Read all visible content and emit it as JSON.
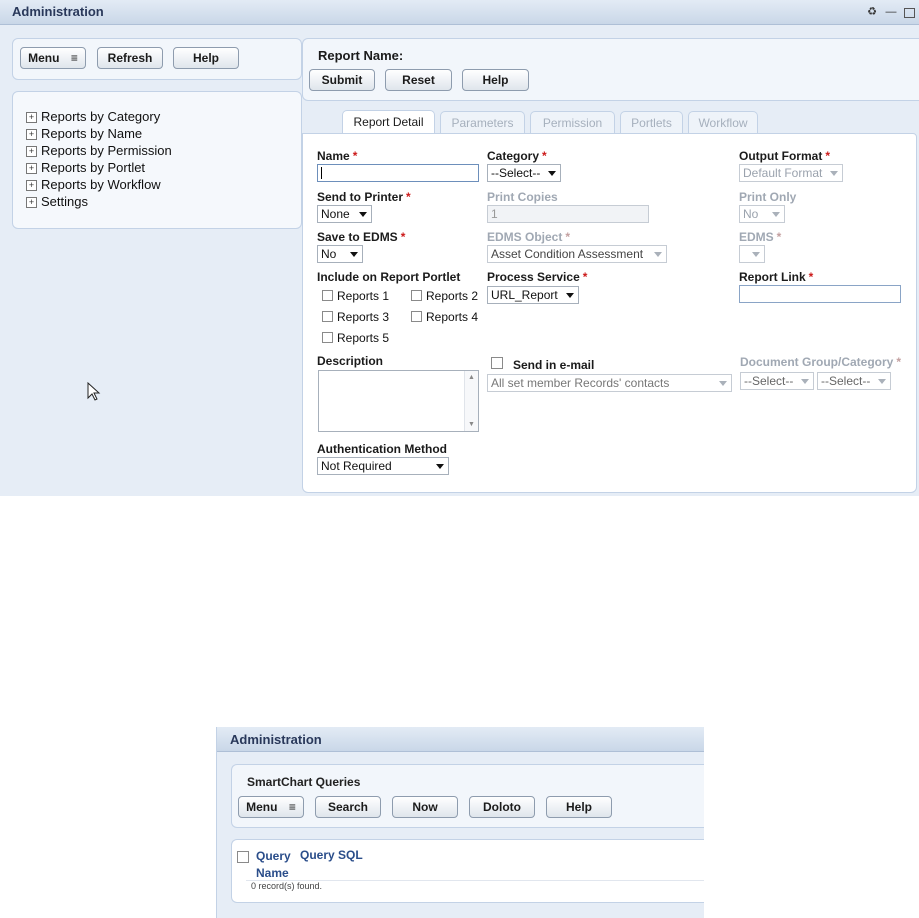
{
  "window": {
    "title": "Administration"
  },
  "left_toolbar": {
    "menu": "Menu",
    "refresh": "Refresh",
    "help": "Help"
  },
  "tree": [
    "Reports by Category",
    "Reports by Name",
    "Reports by Permission",
    "Reports by Portlet",
    "Reports by Workflow",
    "Settings"
  ],
  "report": {
    "header_label": "Report Name:",
    "submit": "Submit",
    "reset": "Reset",
    "help": "Help"
  },
  "tabs": [
    "Report Detail",
    "Parameters",
    "Permission",
    "Portlets",
    "Workflow"
  ],
  "form": {
    "name_label": "Name",
    "category_label": "Category",
    "category_value": "--Select--",
    "output_format_label": "Output Format",
    "output_format_value": "Default Format",
    "send_to_printer_label": "Send to Printer",
    "send_to_printer_value": "None",
    "print_copies_label": "Print Copies",
    "print_copies_value": "1",
    "print_only_label": "Print Only",
    "print_only_value": "No",
    "save_to_edms_label": "Save to EDMS",
    "save_to_edms_value": "No",
    "edms_object_label": "EDMS Object",
    "edms_object_value": "Asset Condition Assessment",
    "edms_label": "EDMS",
    "include_portlet_label": "Include on Report Portlet",
    "portlets": [
      "Reports 1",
      "Reports 2",
      "Reports 3",
      "Reports 4",
      "Reports 5"
    ],
    "process_service_label": "Process Service",
    "process_service_value": "URL_Report",
    "report_link_label": "Report Link",
    "description_label": "Description",
    "send_email_label": "Send in e-mail",
    "email_contacts_value": "All set member Records' contacts",
    "doc_group_label": "Document Group/Category",
    "doc_group_value": "--Select--",
    "doc_category_value": "--Select--",
    "auth_method_label": "Authentication Method",
    "auth_method_value": "Not Required",
    "required_mark": "*"
  },
  "window2": {
    "title": "Administration",
    "panel_title": "SmartChart Queries",
    "menu": "Menu",
    "search": "Search",
    "new": "Now",
    "delete": "Doloto",
    "help": "Help",
    "col_query_name": [
      "Query",
      "Name"
    ],
    "col_query_sql": "Query SQL",
    "records_found": "0 record(s) found."
  }
}
